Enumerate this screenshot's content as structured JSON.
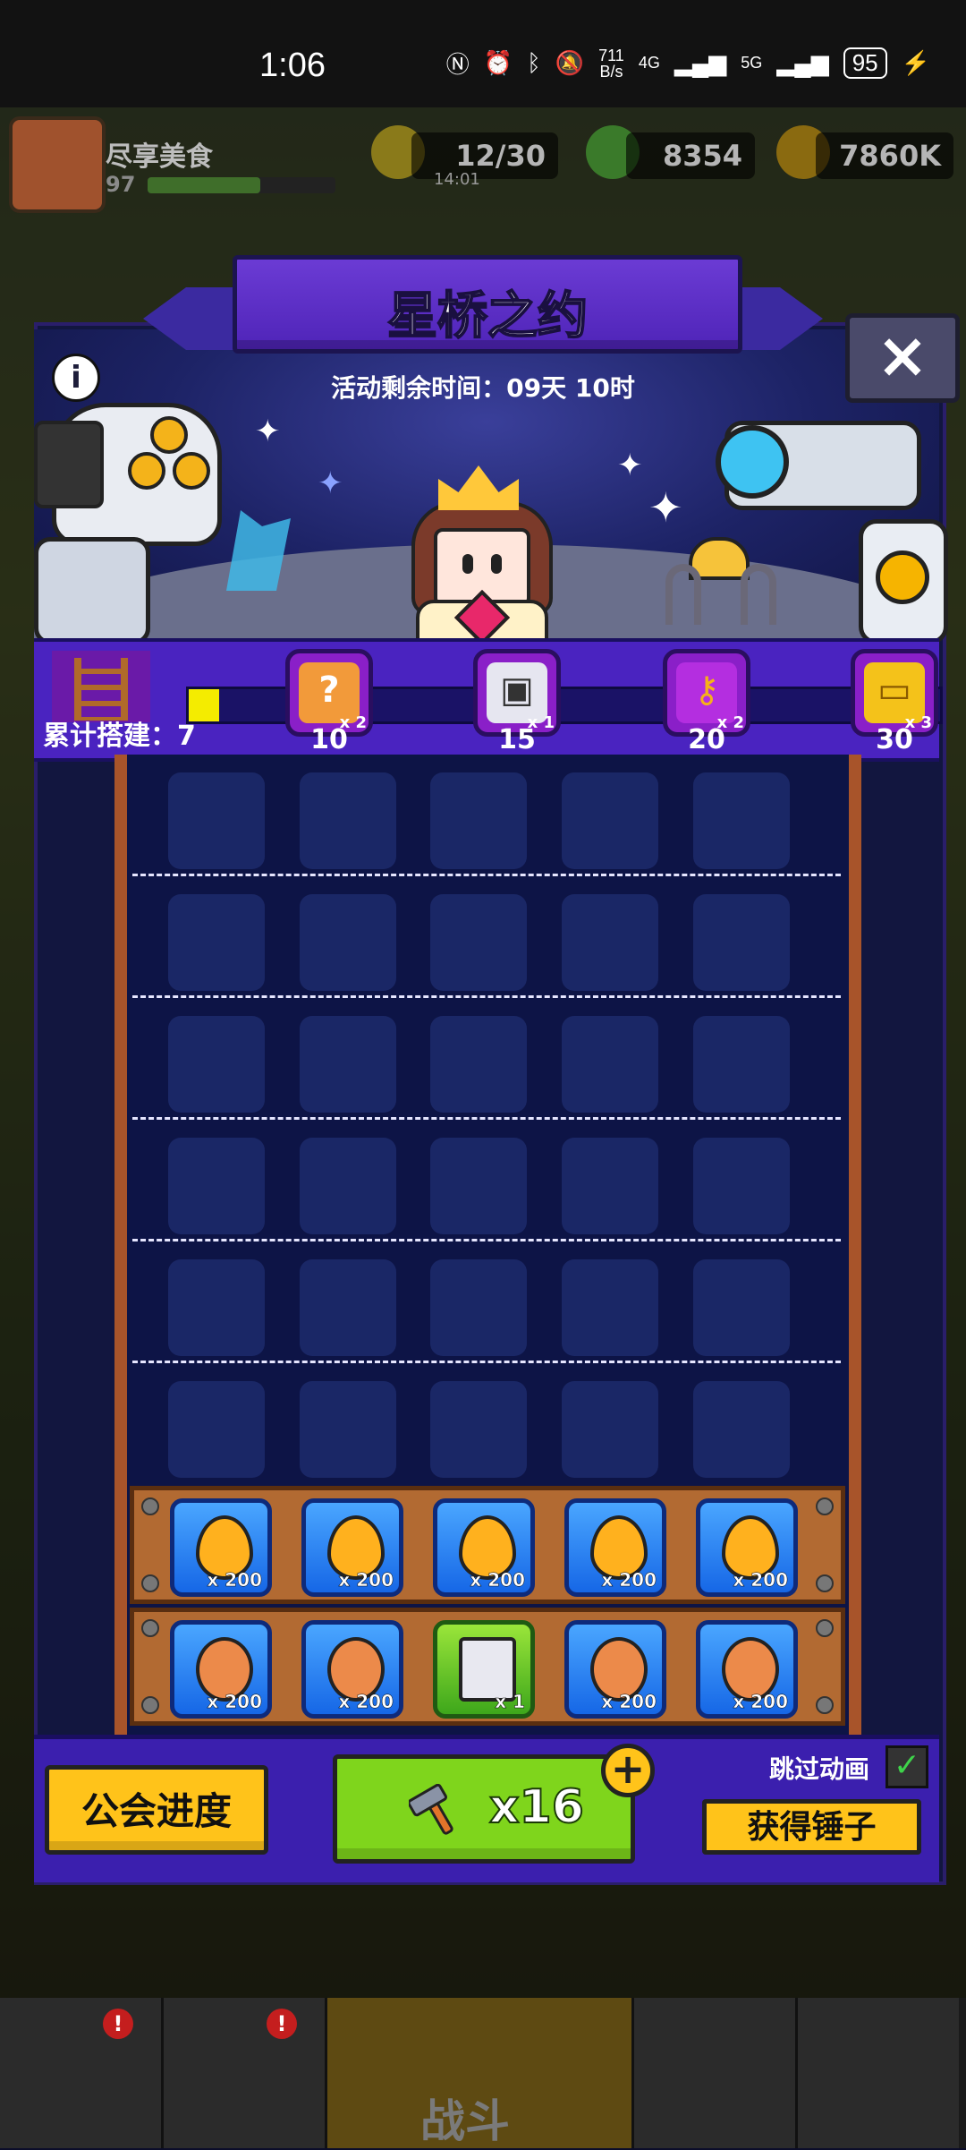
{
  "status_bar": {
    "time": "1:06",
    "net_speed_value": "711",
    "net_speed_unit": "B/s",
    "signal_1": "4G",
    "signal_2": "5G",
    "battery": "95"
  },
  "hud": {
    "player_name": "尽享美食",
    "player_level": "97",
    "energy": "12/30",
    "energy_timer": "14:01",
    "gems": "8354",
    "coins": "7860K"
  },
  "event": {
    "title": "星桥之约",
    "remaining_time": "活动剩余时间：09天 10时",
    "close_label": "×",
    "info_label": "i",
    "cumulative_label": "累计搭建：7",
    "progress": 0.04,
    "milestones": [
      {
        "threshold": "10",
        "count": "x 2",
        "icon": "puzzle-ticket-icon"
      },
      {
        "threshold": "15",
        "count": "x 1",
        "icon": "treasure-chest-icon"
      },
      {
        "threshold": "20",
        "count": "x 2",
        "icon": "golden-key-icon"
      },
      {
        "threshold": "30",
        "count": "x 3",
        "icon": "gold-ticket-icon"
      }
    ]
  },
  "rewards": {
    "row_1": [
      {
        "icon": "fire-drop-icon",
        "amount": "x 200"
      },
      {
        "icon": "fire-drop-icon",
        "amount": "x 200"
      },
      {
        "icon": "fire-drop-icon",
        "amount": "x 200"
      },
      {
        "icon": "fire-drop-icon",
        "amount": "x 200"
      },
      {
        "icon": "fire-drop-icon",
        "amount": "x 200"
      }
    ],
    "row_2": [
      {
        "icon": "lion-badge-icon",
        "amount": "x 200"
      },
      {
        "icon": "lion-badge-icon",
        "amount": "x 200"
      },
      {
        "icon": "treasure-chest-icon",
        "amount": "x 1"
      },
      {
        "icon": "lion-badge-icon",
        "amount": "x 200"
      },
      {
        "icon": "lion-badge-icon",
        "amount": "x 200"
      }
    ]
  },
  "actions": {
    "guild_progress": "公会进度",
    "hammer_count": "x16",
    "plus": "+",
    "skip_animation": "跳过动画",
    "get_hammers": "获得锤子"
  },
  "nav": {
    "battle": "战斗",
    "badge": "!"
  },
  "colors": {
    "panel": "#12163f",
    "banner": "#5a2ec4",
    "yellow_button": "#ffc31a",
    "green_button": "#7fd51c",
    "progress_fill": "#f4ec00"
  }
}
